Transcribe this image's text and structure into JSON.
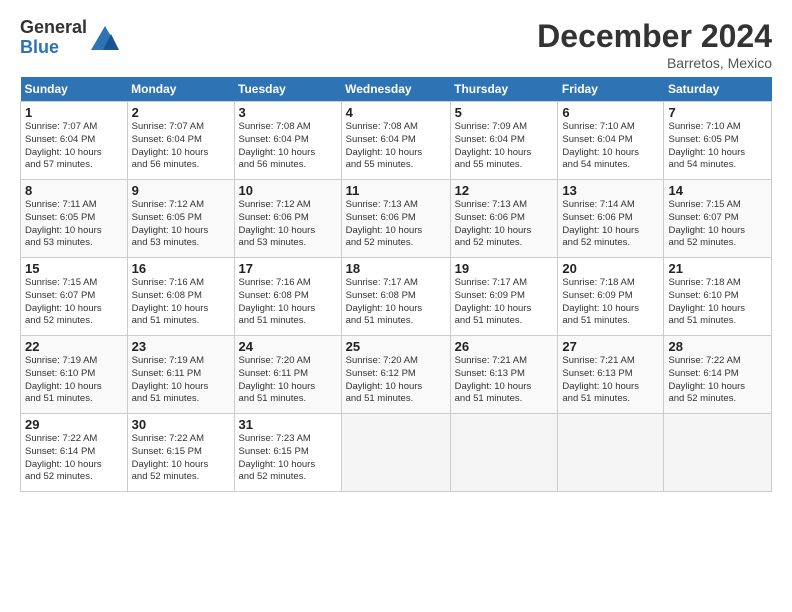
{
  "logo": {
    "general": "General",
    "blue": "Blue"
  },
  "title": "December 2024",
  "location": "Barretos, Mexico",
  "days_of_week": [
    "Sunday",
    "Monday",
    "Tuesday",
    "Wednesday",
    "Thursday",
    "Friday",
    "Saturday"
  ],
  "weeks": [
    [
      {
        "day": "1",
        "info": "Sunrise: 7:07 AM\nSunset: 6:04 PM\nDaylight: 10 hours\nand 57 minutes."
      },
      {
        "day": "2",
        "info": "Sunrise: 7:07 AM\nSunset: 6:04 PM\nDaylight: 10 hours\nand 56 minutes."
      },
      {
        "day": "3",
        "info": "Sunrise: 7:08 AM\nSunset: 6:04 PM\nDaylight: 10 hours\nand 56 minutes."
      },
      {
        "day": "4",
        "info": "Sunrise: 7:08 AM\nSunset: 6:04 PM\nDaylight: 10 hours\nand 55 minutes."
      },
      {
        "day": "5",
        "info": "Sunrise: 7:09 AM\nSunset: 6:04 PM\nDaylight: 10 hours\nand 55 minutes."
      },
      {
        "day": "6",
        "info": "Sunrise: 7:10 AM\nSunset: 6:04 PM\nDaylight: 10 hours\nand 54 minutes."
      },
      {
        "day": "7",
        "info": "Sunrise: 7:10 AM\nSunset: 6:05 PM\nDaylight: 10 hours\nand 54 minutes."
      }
    ],
    [
      {
        "day": "8",
        "info": "Sunrise: 7:11 AM\nSunset: 6:05 PM\nDaylight: 10 hours\nand 53 minutes."
      },
      {
        "day": "9",
        "info": "Sunrise: 7:12 AM\nSunset: 6:05 PM\nDaylight: 10 hours\nand 53 minutes."
      },
      {
        "day": "10",
        "info": "Sunrise: 7:12 AM\nSunset: 6:06 PM\nDaylight: 10 hours\nand 53 minutes."
      },
      {
        "day": "11",
        "info": "Sunrise: 7:13 AM\nSunset: 6:06 PM\nDaylight: 10 hours\nand 52 minutes."
      },
      {
        "day": "12",
        "info": "Sunrise: 7:13 AM\nSunset: 6:06 PM\nDaylight: 10 hours\nand 52 minutes."
      },
      {
        "day": "13",
        "info": "Sunrise: 7:14 AM\nSunset: 6:06 PM\nDaylight: 10 hours\nand 52 minutes."
      },
      {
        "day": "14",
        "info": "Sunrise: 7:15 AM\nSunset: 6:07 PM\nDaylight: 10 hours\nand 52 minutes."
      }
    ],
    [
      {
        "day": "15",
        "info": "Sunrise: 7:15 AM\nSunset: 6:07 PM\nDaylight: 10 hours\nand 52 minutes."
      },
      {
        "day": "16",
        "info": "Sunrise: 7:16 AM\nSunset: 6:08 PM\nDaylight: 10 hours\nand 51 minutes."
      },
      {
        "day": "17",
        "info": "Sunrise: 7:16 AM\nSunset: 6:08 PM\nDaylight: 10 hours\nand 51 minutes."
      },
      {
        "day": "18",
        "info": "Sunrise: 7:17 AM\nSunset: 6:08 PM\nDaylight: 10 hours\nand 51 minutes."
      },
      {
        "day": "19",
        "info": "Sunrise: 7:17 AM\nSunset: 6:09 PM\nDaylight: 10 hours\nand 51 minutes."
      },
      {
        "day": "20",
        "info": "Sunrise: 7:18 AM\nSunset: 6:09 PM\nDaylight: 10 hours\nand 51 minutes."
      },
      {
        "day": "21",
        "info": "Sunrise: 7:18 AM\nSunset: 6:10 PM\nDaylight: 10 hours\nand 51 minutes."
      }
    ],
    [
      {
        "day": "22",
        "info": "Sunrise: 7:19 AM\nSunset: 6:10 PM\nDaylight: 10 hours\nand 51 minutes."
      },
      {
        "day": "23",
        "info": "Sunrise: 7:19 AM\nSunset: 6:11 PM\nDaylight: 10 hours\nand 51 minutes."
      },
      {
        "day": "24",
        "info": "Sunrise: 7:20 AM\nSunset: 6:11 PM\nDaylight: 10 hours\nand 51 minutes."
      },
      {
        "day": "25",
        "info": "Sunrise: 7:20 AM\nSunset: 6:12 PM\nDaylight: 10 hours\nand 51 minutes."
      },
      {
        "day": "26",
        "info": "Sunrise: 7:21 AM\nSunset: 6:13 PM\nDaylight: 10 hours\nand 51 minutes."
      },
      {
        "day": "27",
        "info": "Sunrise: 7:21 AM\nSunset: 6:13 PM\nDaylight: 10 hours\nand 51 minutes."
      },
      {
        "day": "28",
        "info": "Sunrise: 7:22 AM\nSunset: 6:14 PM\nDaylight: 10 hours\nand 52 minutes."
      }
    ],
    [
      {
        "day": "29",
        "info": "Sunrise: 7:22 AM\nSunset: 6:14 PM\nDaylight: 10 hours\nand 52 minutes."
      },
      {
        "day": "30",
        "info": "Sunrise: 7:22 AM\nSunset: 6:15 PM\nDaylight: 10 hours\nand 52 minutes."
      },
      {
        "day": "31",
        "info": "Sunrise: 7:23 AM\nSunset: 6:15 PM\nDaylight: 10 hours\nand 52 minutes."
      },
      null,
      null,
      null,
      null
    ]
  ]
}
